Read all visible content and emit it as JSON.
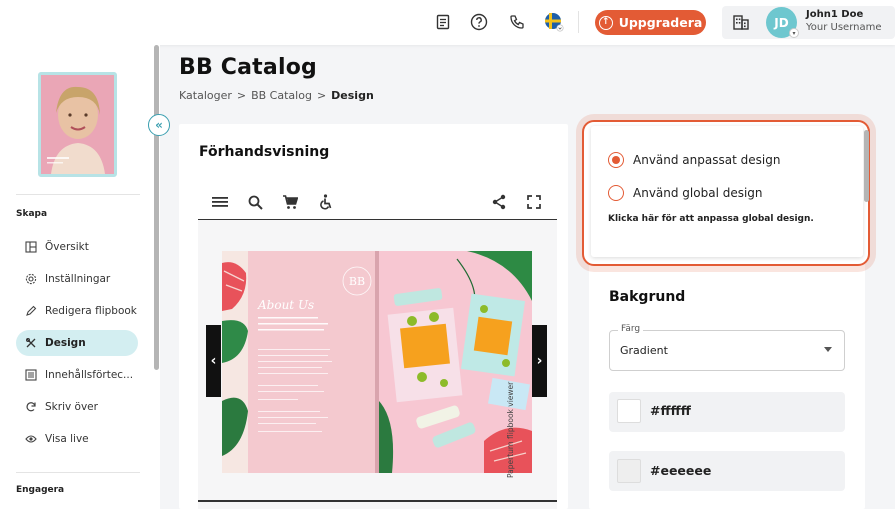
{
  "topbar": {
    "icons": [
      "document-icon",
      "help-icon",
      "phone-icon",
      "swedish-flag-icon"
    ],
    "upgrade_label": "Uppgradera",
    "user": {
      "initials": "JD",
      "name": "John1 Doe",
      "username": "Your Username"
    }
  },
  "sidebar": {
    "section_create": "Skapa",
    "items": [
      {
        "label": "Översikt",
        "icon": "layout-icon"
      },
      {
        "label": "Inställningar",
        "icon": "settings-icon"
      },
      {
        "label": "Redigera flipbook",
        "icon": "pencil-icon"
      },
      {
        "label": "Design",
        "icon": "design-icon",
        "active": true
      },
      {
        "label": "Innehållsförtec...",
        "icon": "list-icon"
      },
      {
        "label": "Skriv över",
        "icon": "refresh-icon"
      },
      {
        "label": "Visa live",
        "icon": "eye-icon"
      }
    ],
    "section_engage": "Engagera"
  },
  "header": {
    "title": "BB Catalog",
    "breadcrumb": [
      "Kataloger",
      "BB Catalog",
      "Design"
    ],
    "separator": ">"
  },
  "preview": {
    "title": "Förhandsvisning",
    "toolbar_icons": [
      "menu-icon",
      "search-icon",
      "cart-icon",
      "accessibility-icon",
      "share-icon",
      "fullscreen-icon"
    ],
    "left_page": {
      "heading": "About Us",
      "logo": "BB"
    },
    "watermark": "Paperturn flipbook viewer"
  },
  "design_options": {
    "custom_label": "Använd anpassat design",
    "global_label": "Använd global design",
    "selected": "custom",
    "global_link": "Klicka här för att anpassa global design."
  },
  "background": {
    "title": "Bakgrund",
    "select_label": "Färg",
    "select_value": "Gradient",
    "colors": [
      "#ffffff",
      "#eeeeee"
    ]
  },
  "colors": {
    "accent": "#e35b35",
    "sidebar_active": "#d3eef1",
    "avatar": "#6ec7cf",
    "collapse": "#3a9fb0"
  }
}
